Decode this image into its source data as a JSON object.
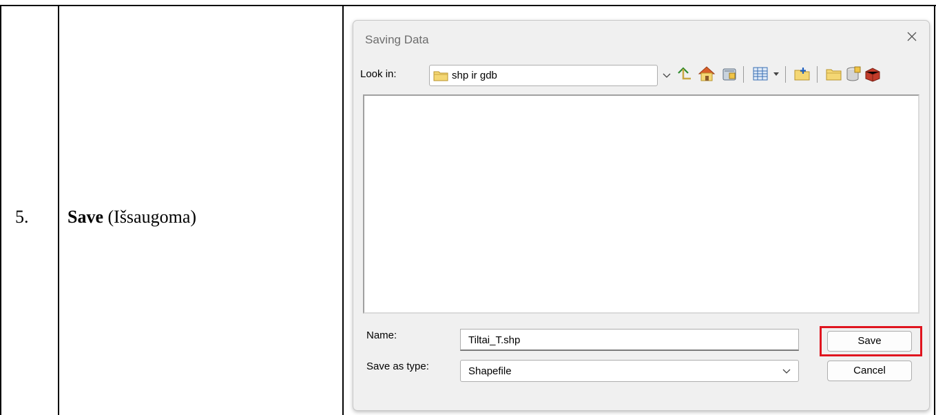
{
  "document": {
    "step_number": "5.",
    "step_bold": "Save",
    "step_rest": " (Išsaugoma)"
  },
  "dialog": {
    "title": "Saving Data",
    "look_in_label": "Look in:",
    "look_in_value": "shp ir gdb",
    "toolbar_icons": [
      "up-one-level-icon",
      "home-icon",
      "catalog-icon",
      "view-menu-icon",
      "connect-folder-icon",
      "new-folder-icon",
      "new-geodatabase-icon",
      "toolbox-icon"
    ],
    "name_label": "Name:",
    "name_value": "Tiltai_T.shp",
    "save_as_type_label": "Save as type:",
    "save_as_type_value": "Shapefile",
    "save_button": "Save",
    "cancel_button": "Cancel",
    "highlight_color": "#e0141e"
  }
}
